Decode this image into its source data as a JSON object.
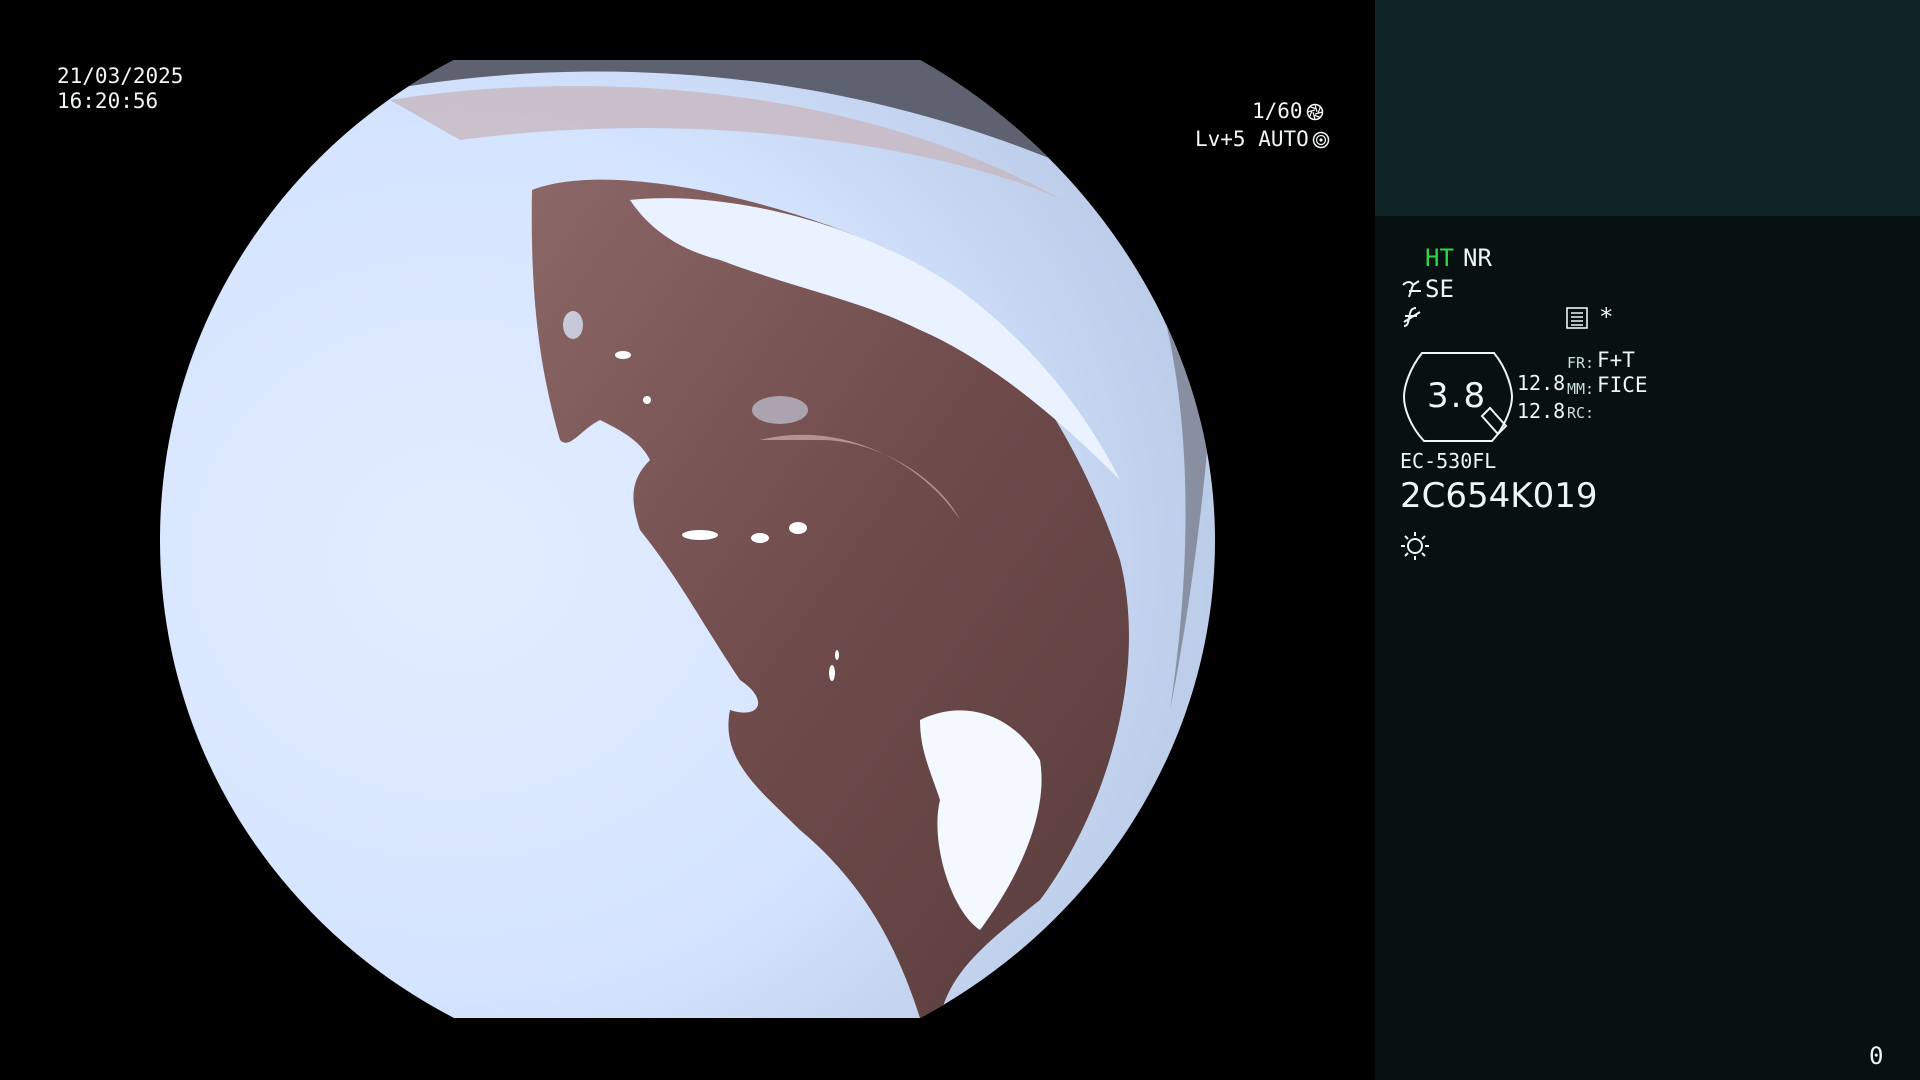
{
  "overlay": {
    "date": "21/03/2025",
    "time": "16:20:56",
    "shutter": "1/60",
    "shutter_icon": "aperture-icon",
    "exposure": "Lv+5 AUTO",
    "exposure_icon": "iris-icon"
  },
  "panel": {
    "ht": "HT",
    "nr": "NR",
    "se": "SE",
    "zoom": "3.8",
    "num_top": "12.8",
    "num_bottom": "12.8",
    "fr_label": "FR:",
    "fr_value": "F+T",
    "mm_label": "MM:",
    "mm_value": "FICE",
    "rc_label": "RC:",
    "model": "EC-530FL",
    "serial": "2C654K019",
    "counter": "0",
    "colors": {
      "ht": "#2fd64a",
      "panel_bg": "#061110",
      "panel_top_bg": "#0f2525"
    }
  }
}
